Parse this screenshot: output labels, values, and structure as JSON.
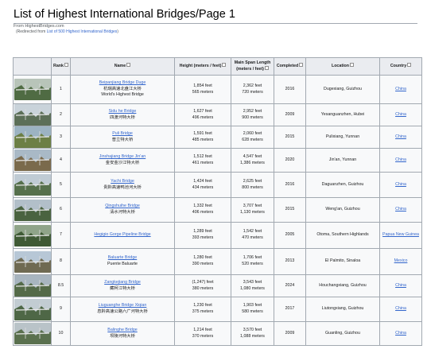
{
  "page": {
    "title": "List of Highest International Bridges/Page 1",
    "from_text": "From HighestBridges.com",
    "redirect_prefix": "(Redirected from ",
    "redirect_link": "List of 500 Highest International Bridges",
    "redirect_suffix": ")"
  },
  "table": {
    "headers": {
      "rank": "Rank",
      "name": "Name",
      "height": "Height (meters / feet)",
      "span_line1": "Main Span Length",
      "span_line2": "(meters / feet)",
      "completed": "Completed",
      "location": "Location",
      "country": "Country"
    },
    "rows": [
      {
        "rank": "1",
        "name": "Beipanjiang Bridge Duge",
        "name_cn": "杭瑞高速北盘江大桥",
        "name_extra": "World's Highest Bridge",
        "height_ft": "1,854 feet",
        "height_m": "565 meters",
        "span_ft": "2,362 feet",
        "span_m": "720 meters",
        "year": "2016",
        "location": "Dugexiang, Guizhou",
        "country": "China",
        "thumb": "mountain-bridge-thumbnail",
        "sky": "#b8c4b9",
        "ground": "#4f6b43"
      },
      {
        "rank": "2",
        "name": "Sidu he Bridge",
        "name_cn": "四渡河特大桥",
        "height_ft": "1,627 feet",
        "height_m": "496 meters",
        "span_ft": "2,952 feet",
        "span_m": "900 meters",
        "year": "2009",
        "location": "Yesanguanzhen, Hubei",
        "country": "China",
        "thumb": "suspension-bridge-thumbnail",
        "sky": "#c9d3da",
        "ground": "#5c6f58"
      },
      {
        "rank": "3",
        "name": "Puli Bridge",
        "name_cn": "普立特大桥",
        "height_ft": "1,591 feet",
        "height_m": "485 meters",
        "span_ft": "2,060 feet",
        "span_m": "628 meters",
        "year": "2015",
        "location": "Pulixiang, Yunnan",
        "country": "China",
        "thumb": "gorge-bridge-thumbnail",
        "sky": "#9cb3c2",
        "ground": "#6c7f45"
      },
      {
        "rank": "4",
        "name": "Jinshajiang Bridge Jin'an",
        "name_cn": "金安金沙江特大桥",
        "height_ft": "1,512 feet",
        "height_m": "461 meters",
        "span_ft": "4,547 feet",
        "span_m": "1,386 meters",
        "year": "2020",
        "location": "Jin'an, Yunnan",
        "country": "China",
        "thumb": "river-bridge-thumbnail",
        "sky": "#a9b9c6",
        "ground": "#7a6a4c"
      },
      {
        "rank": "5",
        "name": "Yachi Bridge",
        "name_cn": "贵黔高速鸭池河大桥",
        "height_ft": "1,424 feet",
        "height_m": "434 meters",
        "span_ft": "2,625 feet",
        "span_m": "800 meters",
        "year": "2016",
        "location": "Daguanzhen, Guizhou",
        "country": "China",
        "thumb": "cable-bridge-thumbnail",
        "sky": "#bfcbd4",
        "ground": "#56704c"
      },
      {
        "rank": "6",
        "name": "Qingshuihe Bridge",
        "name_cn": "清水河特大桥",
        "height_ft": "1,332 feet",
        "height_m": "406 meters",
        "span_ft": "3,707 feet",
        "span_m": "1,130 meters",
        "year": "2015",
        "location": "Weng'an, Guizhou",
        "country": "China",
        "thumb": "valley-bridge-thumbnail",
        "sky": "#b2bfc9",
        "ground": "#4a6340"
      },
      {
        "rank": "7",
        "name": "Hegigio Gorge Pipeline Bridge",
        "height_ft": "1,289 feet",
        "height_m": "393 meters",
        "span_ft": "1,542 feet",
        "span_m": "470 meters",
        "year": "2005",
        "location": "Otoma, Southern Highlands",
        "country": "Papua New Guinea",
        "thumb": "pipeline-bridge-thumbnail",
        "sky": "#8fa489",
        "ground": "#3f5a35"
      },
      {
        "rank": "8",
        "name": "Baluarte Bridge",
        "name_cn": "Puente Baluarte",
        "height_ft": "1,280 feet",
        "height_m": "390 meters",
        "span_ft": "1,706 feet",
        "span_m": "520 meters",
        "year": "2013",
        "location": "El Palmito, Sinaloa",
        "country": "Mexico",
        "thumb": "cable-stayed-bridge-thumbnail",
        "sky": "#b7c7d6",
        "ground": "#6f6a52"
      },
      {
        "rank": "8.5",
        "name": "Zangkejiang Bridge",
        "name_cn": "藏柯江特大桥",
        "height_ft": "(1,247) feet",
        "height_m": "380 meters",
        "span_ft": "3,543 feet",
        "span_m": "1,080 meters",
        "year": "2024",
        "location": "Houchangxiang, Guizhou",
        "country": "China",
        "thumb": "construction-bridge-thumbnail",
        "sky": "#a8b5bf",
        "ground": "#546a48"
      },
      {
        "rank": "9",
        "name": "Liuguanghe Bridge Xiqian",
        "name_cn": "息黔高速公路六广河特大桥",
        "height_ft": "1,230 feet",
        "height_m": "375 meters",
        "span_ft": "1,903 feet",
        "span_m": "580 meters",
        "year": "2017",
        "location": "Liutongxiang, Guizhou",
        "country": "China",
        "thumb": "truss-bridge-thumbnail",
        "sky": "#c2ccd2",
        "ground": "#4e6746"
      },
      {
        "rank": "10",
        "name": "Balinghe Bridge",
        "name_cn": "坝陵河特大桥",
        "height_ft": "1,214 feet",
        "height_m": "370 meters",
        "span_ft": "3,570 feet",
        "span_m": "1,088 meters",
        "year": "2009",
        "location": "Guanling, Guizhou",
        "country": "China",
        "thumb": "long-span-bridge-thumbnail",
        "sky": "#b9c3c8",
        "ground": "#5a704e"
      }
    ]
  }
}
